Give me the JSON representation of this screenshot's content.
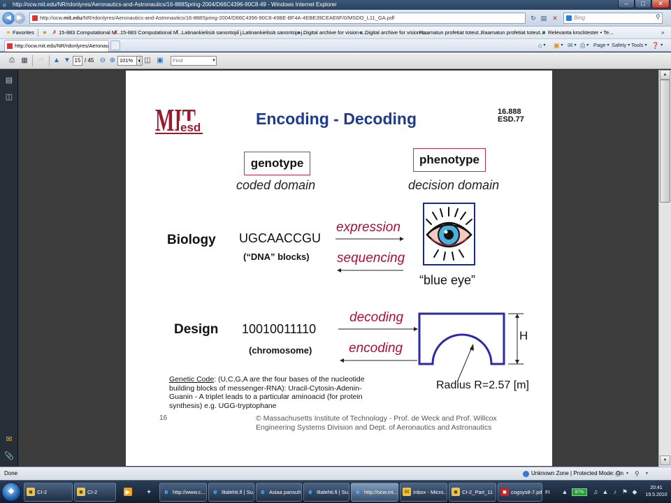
{
  "window": {
    "title": "http://ocw.mit.edu/NR/rdonlyres/Aeronautics-and-Astronautics/16-888Spring-2004/D66C4396-90C8-49 - Windows Internet Explorer",
    "minimize": "‒",
    "maximize": "□",
    "close": "✕"
  },
  "address_bar": {
    "url_prefix": "http://ocw.",
    "url_domain": "mit.edu",
    "url_rest": "/NR/rdonlyres/Aeronautics-and-Astronautics/16-888Spring-2004/D66C4396-90C8-49BE-BF4A-4EBE39CEAE6F/0/MSDO_L11_GA.pdf",
    "search_placeholder": "Bing"
  },
  "favorites_bar": {
    "favorites_label": "Favorites",
    "items": [
      "15-883 Computational M...",
      "15-883 Computational M...",
      "Latinankielisiä sanontoja j...",
      "Latinankielisiä sanontoja j...",
      "Digital archive for vision s...",
      "Digital archive for vision s...",
      "Raamatun profetiat toteut...",
      "Raamatun profetiat toteut...",
      "Relevanta krocktester • Te..."
    ]
  },
  "tab_bar": {
    "active_tab": "http://ocw.mit.edu/NR/rdonlyres/Aeronautics-a...",
    "commands": [
      "Page",
      "Safety",
      "Tools"
    ]
  },
  "pdf_toolbar": {
    "current_page": "15",
    "total_pages": "/ 45",
    "zoom": "101%",
    "find_placeholder": "Find"
  },
  "slide": {
    "logo_main": "MIT",
    "logo_sub": "esd",
    "title": "Encoding - Decoding",
    "course_code_1": "16.888",
    "course_code_2": "ESD.77",
    "genotype": "genotype",
    "phenotype": "phenotype",
    "coded_domain": "coded domain",
    "decision_domain": "decision domain",
    "biology": "Biology",
    "design": "Design",
    "dna_sequence": "UGCAACCGU",
    "dna_note": "(“DNA” blocks)",
    "chromosome_sequence": "10010011110",
    "chromosome_note": "(chromosome)",
    "expression": "expression",
    "sequencing": "sequencing",
    "decoding": "decoding",
    "encoding": "encoding",
    "blue_eye": "“blue eye”",
    "height_label": "H",
    "radius_label": "Radius R=2.57 [m]",
    "genetic_code_title": "Genetic Code",
    "genetic_code_text": ": (U,C,G,A are the four bases of the nucleotide building blocks of messenger-RNA): Uracil-Cytosin-Adenin-Guanin - A triplet leads to a particular aminoacid (for protein synthesis) e.g. UGG-tryptophane",
    "page_number": "16",
    "copyright_1": "© Massachusetts Institute of Technology - Prof. de Weck and Prof. Willcox",
    "copyright_2": "Engineering Systems Division and Dept. of Aeronautics and Astronautics"
  },
  "status_bar": {
    "status": "Done",
    "zone": "Unknown Zone | Protected Mode: On"
  },
  "taskbar": {
    "buttons": [
      "CI-2",
      "CI-2",
      "http://www.c...",
      "Iltalehti.fi | Su...",
      "Asiaa pansuht...",
      "Iltalehti.fi | Su...",
      "http://ocw.mi...",
      "Inbox - Micro...",
      "CI-2_Part_11",
      "cogsys8-7.pd..."
    ],
    "language": "FI",
    "battery": "97%",
    "time": "20:41",
    "date": "19.5.2010"
  },
  "colors": {
    "title_blue": "#1e3a8a",
    "accent_red": "#b01030",
    "box_border": "#c0304a",
    "diagram_blue": "#2a2aa8"
  }
}
